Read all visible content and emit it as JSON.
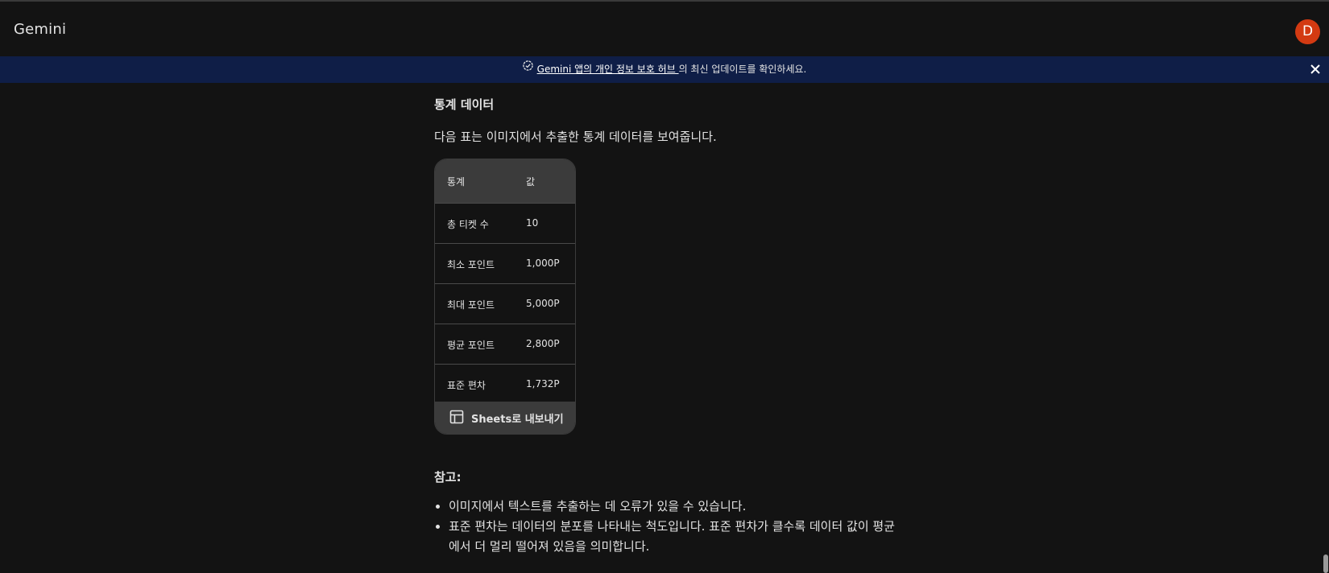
{
  "app": {
    "title": "Gemini",
    "avatar_letter": "D"
  },
  "banner": {
    "link_text": "Gemini 앱의 개인 정보 보호 허브 ",
    "suffix_text": "의 최신 업데이트를 확인하세요."
  },
  "main": {
    "section_title": "통계 데이터",
    "intro": "다음 표는 이미지에서 추출한 통계 데이터를 보여줍니다.",
    "table": {
      "headers": [
        "통계",
        "값"
      ],
      "rows": [
        [
          "총 티켓 수",
          "10"
        ],
        [
          "최소 포인트",
          "1,000P"
        ],
        [
          "최대 포인트",
          "5,000P"
        ],
        [
          "평균 포인트",
          "2,800P"
        ],
        [
          "표준 편차",
          "1,732P"
        ]
      ],
      "export_label": "Sheets로 내보내기"
    },
    "note_title": "참고:",
    "notes": [
      "이미지에서 텍스트를 추출하는 데 오류가 있을 수 있습니다.",
      "표준 편차는 데이터의 분포를 나타내는 척도입니다. 표준 편차가 클수록 데이터 값이 평균에서 더 멀리 떨어져 있음을 의미합니다."
    ]
  },
  "colors": {
    "background": "#131313",
    "banner": "#0f1e47",
    "avatar": "#d33a12",
    "table_header": "#3b3b3b"
  }
}
